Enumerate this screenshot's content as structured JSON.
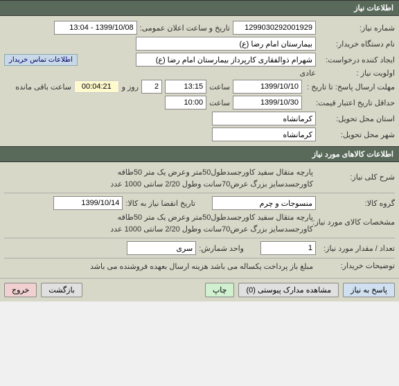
{
  "sections": {
    "need_info": "اطلاعات نیاز",
    "goods_info": "اطلاعات کالاهای مورد نیاز"
  },
  "labels": {
    "need_number": "شماره نیاز:",
    "announce_datetime": "تاریخ و ساعت اعلان عمومی:",
    "org_name": "نام دستگاه خریدار:",
    "creator": "ایجاد کننده درخواست:",
    "buyer_contact": "اطلاعات تماس خریدار",
    "priority": "اولویت نیاز :",
    "response_deadline_from": "مهلت ارسال پاسخ:  تا تاریخ :",
    "time": "ساعت",
    "days_and": "روز و",
    "remaining": "ساعت باقی مانده",
    "price_validity": "حداقل تاریخ اعتبار قیمت:",
    "delivery_province": "استان محل تحویل:",
    "delivery_city": "شهر محل تحویل:",
    "general_desc": "شرح کلی نیاز:",
    "goods_group": "گروه کالا:",
    "expire_date": "تاریخ انقضا نیاز به کالا:",
    "goods_spec": "مشخصات کالای مورد نیاز:",
    "qty": "تعداد / مقدار مورد نیاز:",
    "unit": "واحد شمارش:",
    "buyer_notes": "توضیحات خریدار:"
  },
  "values": {
    "need_number": "1299030292001929",
    "announce_datetime": "1399/10/08 - 13:04",
    "org_name": "بیمارستان امام رضا (ع)",
    "creator": "شهرام ذوالفقاری کارپرداز بیمارستان امام رضا (ع)",
    "priority": "عادی",
    "deadline_date": "1399/10/10",
    "deadline_time": "13:15",
    "days_left": "2",
    "countdown": "00:04:21",
    "price_validity_date": "1399/10/30",
    "price_validity_time": "10:00",
    "delivery_province": "کرمانشاه",
    "delivery_city": "کرمانشاه",
    "general_desc_l1": "پارچه متقال سفید کاورجسدطول50متر وعرض یک متر 50طاقه",
    "general_desc_l2": "کاورجسدسایز بزرگ عرض70سانت وطول 2/20 سانتی  1000 عدد",
    "goods_group": "منسوجات و چرم",
    "expire_date": "1399/10/14",
    "goods_spec_l1": "پارچه متقال سفید کاورجسدطول50متر وعرض یک متر 50طاقه",
    "goods_spec_l2": "کاورجسدسایز بزرگ عرض70سانت وطول 2/20 سانتی  1000 عدد",
    "qty": "1",
    "unit": "سری",
    "buyer_notes": "مبلغ باز پرداخت یکساله می باشد هزینه ارسال بعهده فروشنده می باشد"
  },
  "buttons": {
    "respond": "پاسخ به نیاز",
    "attachments": "مشاهده مدارک پیوستی (0)",
    "print": "چاپ",
    "back": "بازگشت",
    "exit": "خروج"
  }
}
